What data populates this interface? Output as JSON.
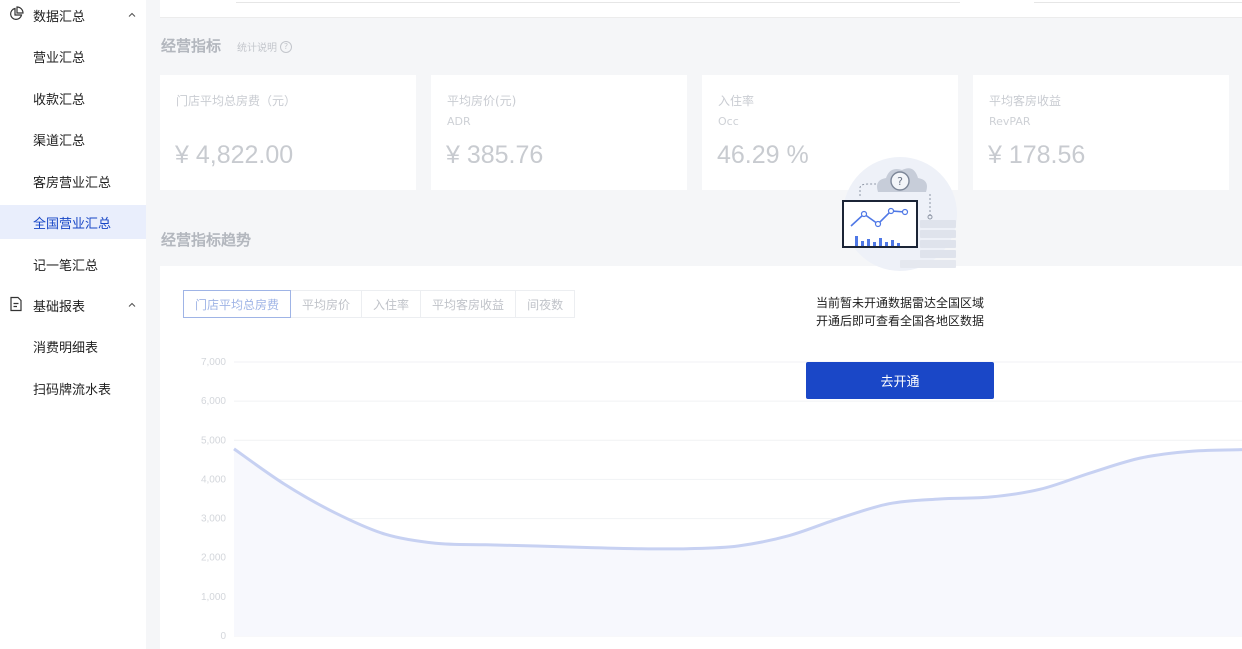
{
  "sidebar": {
    "group_data": "数据汇总",
    "items_data": [
      {
        "label": "营业汇总"
      },
      {
        "label": "收款汇总"
      },
      {
        "label": "渠道汇总"
      },
      {
        "label": "客房营业汇总"
      },
      {
        "label": "全国营业汇总"
      },
      {
        "label": "记一笔汇总"
      }
    ],
    "group_reports": "基础报表",
    "items_reports": [
      {
        "label": "消费明细表"
      },
      {
        "label": "扫码牌流水表"
      }
    ]
  },
  "metrics": {
    "title": "经营指标",
    "note": "统计说明",
    "cards": [
      {
        "label": "门店平均总房费（元）",
        "sub": "",
        "value": "¥ 4,822.00"
      },
      {
        "label": "平均房价(元)",
        "sub": "ADR",
        "value": "¥ 385.76"
      },
      {
        "label": "入住率",
        "sub": "Occ",
        "value": "46.29 %"
      },
      {
        "label": "平均客房收益",
        "sub": "RevPAR",
        "value": "¥ 178.56"
      }
    ]
  },
  "trend": {
    "title": "经营指标趋势",
    "tabs": [
      {
        "label": "门店平均总房费"
      },
      {
        "label": "平均房价"
      },
      {
        "label": "入住率"
      },
      {
        "label": "平均客房收益"
      },
      {
        "label": "间夜数"
      }
    ]
  },
  "chart_data": {
    "type": "line",
    "title": "",
    "xlabel": "",
    "ylabel": "",
    "ylim": [
      0,
      7000
    ],
    "yticks": [
      "0",
      "1,000",
      "2,000",
      "3,000",
      "4,000",
      "5,000",
      "6,000",
      "7,000"
    ],
    "grid": true,
    "series": [
      {
        "values": [
          4780,
          3880,
          3150,
          2600,
          2370,
          2330,
          2300,
          2260,
          2230,
          2230,
          2300,
          2560,
          3000,
          3380,
          3500,
          3550,
          3750,
          4170,
          4550,
          4720,
          4760
        ]
      }
    ]
  },
  "overlay": {
    "line1": "当前暂未开通数据雷达全国区域",
    "line2": "开通后即可查看全国各地区数据",
    "button": "去开通"
  },
  "colors": {
    "accent": "#1a47c7",
    "active_bg": "#e9eefc",
    "line": "#c7d1f2"
  }
}
